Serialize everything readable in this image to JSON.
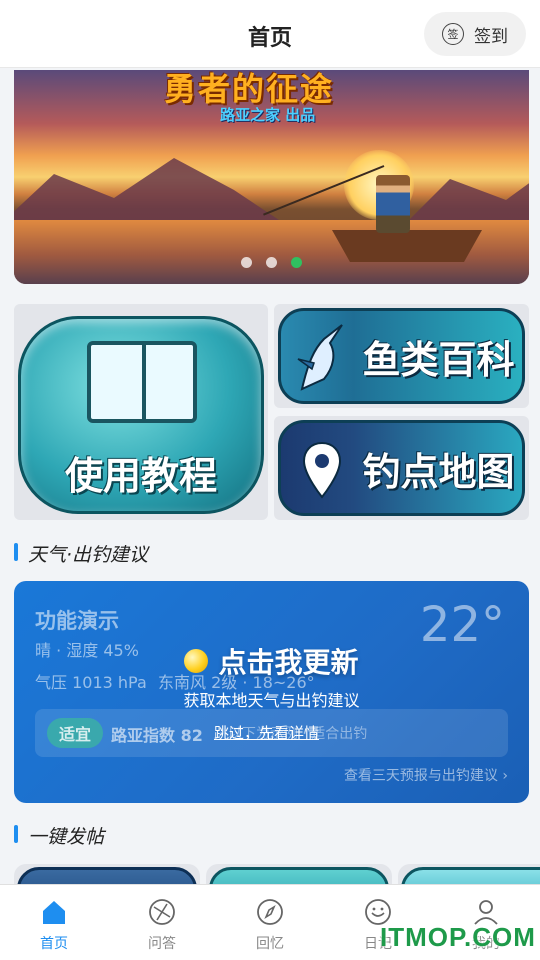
{
  "header": {
    "title": "首页",
    "signin_icon": "签",
    "signin_label": "签到"
  },
  "banner": {
    "heading": "勇者的征途",
    "subtitle": "路亚之家 出品",
    "active_index": 3,
    "count": 3
  },
  "tiles": {
    "tutorial": "使用教程",
    "fish_wiki": "鱼类百科",
    "spot_map": "钓点地图"
  },
  "weather_section": {
    "title": "天气·出钓建议"
  },
  "weather": {
    "location": "功能演示",
    "condition": "晴 · 湿度 45%",
    "pressure": "气压 1013 hPa",
    "wind": "东南风 2级 · 18~26°",
    "temperature": "22°",
    "suitability": "适宜",
    "lure_index": "路亚指数 82",
    "hint": "· 以下为示例 · 适合出钓",
    "overlay_title": "点击我更新",
    "overlay_subtitle": "获取本地天气与出钓建议",
    "overlay_link": "跳过，先看详情",
    "more_link": "查看三天预报与出钓建议 ›"
  },
  "post_section": {
    "title": "一键发帖"
  },
  "tabbar": [
    {
      "label": "首页",
      "icon": "home-icon",
      "active": true
    },
    {
      "label": "问答",
      "icon": "compass-icon",
      "active": false
    },
    {
      "label": "回忆",
      "icon": "navigate-icon",
      "active": false
    },
    {
      "label": "日记",
      "icon": "smile-icon",
      "active": false
    },
    {
      "label": "我的",
      "icon": "user-icon",
      "active": false
    }
  ],
  "watermark": "ITMOP.COM",
  "colors": {
    "accent": "#1e8ef0",
    "weather_card": "#1f6bc6",
    "active_dot": "#30c060"
  }
}
